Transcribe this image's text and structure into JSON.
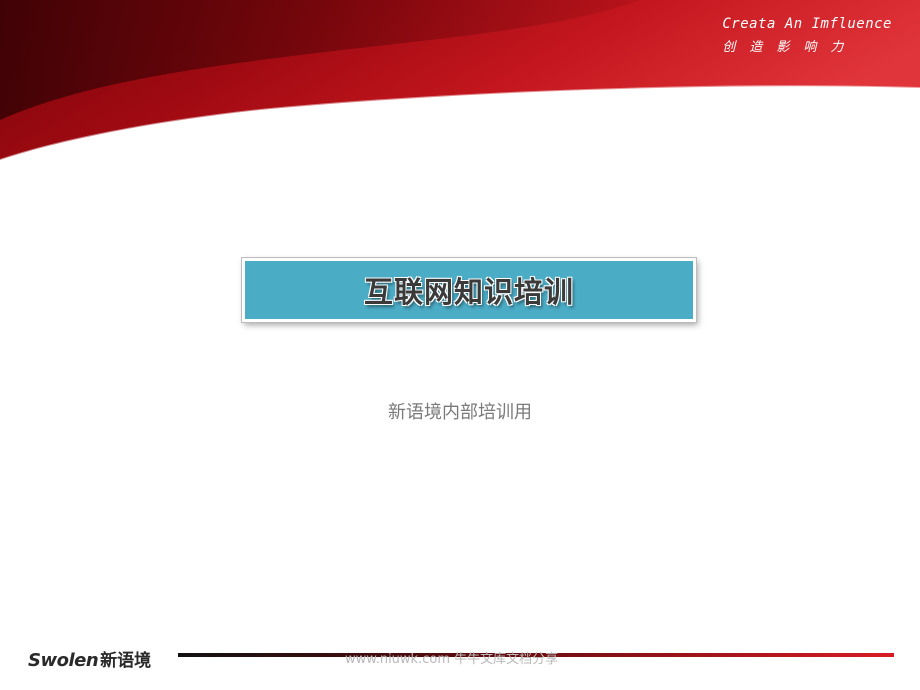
{
  "header": {
    "tagline_en": "Creata An Imfluence",
    "tagline_cn": "创造影响力"
  },
  "title": {
    "text": "互联网知识培训"
  },
  "subtitle": {
    "text": "新语境内部培训用"
  },
  "footer": {
    "logo_en": "Swolen",
    "logo_cn": "新语境",
    "watermark": "www.niuwk.com 牛牛文库文档分享"
  },
  "colors": {
    "brand_red": "#c0121c",
    "title_box": "#4bacc6"
  }
}
